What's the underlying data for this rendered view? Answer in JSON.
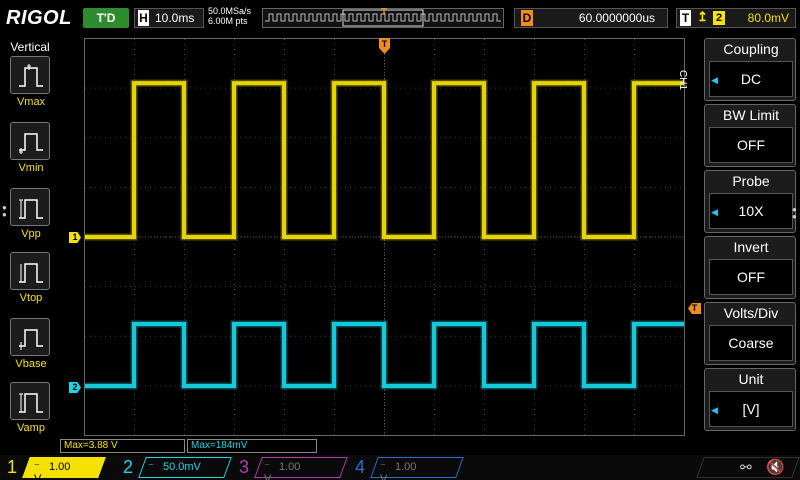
{
  "header": {
    "logo": "RIGOL",
    "run_state": "T'D",
    "horizontal": {
      "label": "H",
      "timebase": "10.0ms"
    },
    "sample_rate": "50.0MSa/s",
    "memory_depth": "6.00M pts",
    "trigger_position_marker": "T",
    "delay": {
      "label": "D",
      "value": "60.0000000us"
    },
    "trigger": {
      "label": "T",
      "edge_icon": "rising-edge-icon",
      "source": "2",
      "level": "80.0mV"
    }
  },
  "left_menu": {
    "title": "Vertical",
    "items": [
      {
        "label": "Vmax",
        "icon": "vmax-icon"
      },
      {
        "label": "Vmin",
        "icon": "vmin-icon"
      },
      {
        "label": "Vpp",
        "icon": "vpp-icon"
      },
      {
        "label": "Vtop",
        "icon": "vtop-icon"
      },
      {
        "label": "Vbase",
        "icon": "vbase-icon"
      },
      {
        "label": "Vamp",
        "icon": "vamp-icon"
      }
    ]
  },
  "markers": {
    "ch1": "1",
    "ch2": "2",
    "trigger_level": "T",
    "trigger_time": "T"
  },
  "measurements": {
    "m1": "Max=3.88 V",
    "m2": "Max=184mV"
  },
  "right_menu": {
    "channel_label": "CH1",
    "items": [
      {
        "title": "Coupling",
        "value": "DC"
      },
      {
        "title": "BW Limit",
        "value": "OFF"
      },
      {
        "title": "Probe",
        "value": "10X"
      },
      {
        "title": "Invert",
        "value": "OFF"
      },
      {
        "title": "Volts/Div",
        "value": "Coarse"
      },
      {
        "title": "Unit",
        "value": "[V]"
      }
    ]
  },
  "channels": [
    {
      "num": "1",
      "scale": "1.00 V",
      "color": "#f5e200",
      "active": true
    },
    {
      "num": "2",
      "scale": "50.0mV",
      "color": "#18d6e8",
      "active": true
    },
    {
      "num": "3",
      "scale": "1.00 V",
      "color": "#b03cb0",
      "active": false
    },
    {
      "num": "4",
      "scale": "1.00 V",
      "color": "#2a6fc8",
      "active": false
    }
  ],
  "status_icons": {
    "usb": "usb-icon",
    "speaker": "speaker-muted-icon"
  },
  "waveforms": {
    "ch1": {
      "color": "#f5e200",
      "shape": "square",
      "period_divisions": 2,
      "high_level_divisions": 3.1,
      "low_level_divisions": 0
    },
    "ch2": {
      "color": "#18d6e8",
      "shape": "square",
      "period_divisions": 2,
      "high_level_divisions": 1.25,
      "low_level_divisions": 0
    }
  }
}
